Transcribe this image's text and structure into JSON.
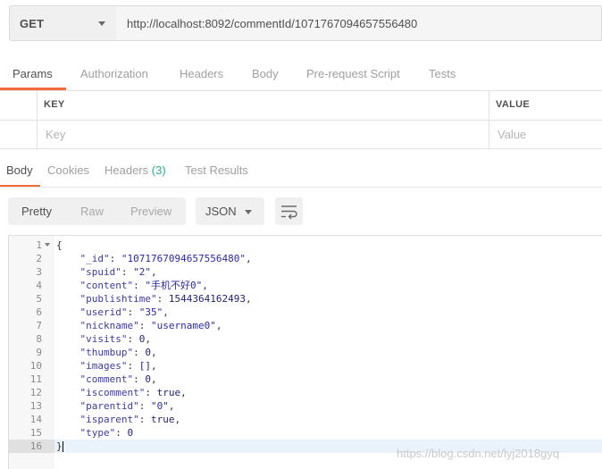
{
  "request": {
    "method": "GET",
    "url": "http://localhost:8092/commentId/1071767094657556480"
  },
  "request_tabs": [
    "Params",
    "Authorization",
    "Headers",
    "Body",
    "Pre-request Script",
    "Tests"
  ],
  "params_table": {
    "key_header": "KEY",
    "value_header": "VALUE",
    "key_placeholder": "Key",
    "value_placeholder": "Value"
  },
  "response_tabs": {
    "body": "Body",
    "cookies": "Cookies",
    "headers": "Headers",
    "headers_count": "(3)",
    "test_results": "Test Results"
  },
  "toolbar": {
    "pretty": "Pretty",
    "raw": "Raw",
    "preview": "Preview",
    "format": "JSON",
    "wrap_icon": "wrap-lines-icon"
  },
  "editor": {
    "lines": [
      {
        "n": "1",
        "text": "{"
      },
      {
        "n": "2",
        "text": "    \"_id\": \"1071767094657556480\","
      },
      {
        "n": "3",
        "text": "    \"spuid\": \"2\","
      },
      {
        "n": "4",
        "text": "    \"content\": \"手机不好0\","
      },
      {
        "n": "5",
        "text": "    \"publishtime\": 1544364162493,"
      },
      {
        "n": "6",
        "text": "    \"userid\": \"35\","
      },
      {
        "n": "7",
        "text": "    \"nickname\": \"username0\","
      },
      {
        "n": "8",
        "text": "    \"visits\": 0,"
      },
      {
        "n": "9",
        "text": "    \"thumbup\": 0,"
      },
      {
        "n": "10",
        "text": "    \"images\": [],"
      },
      {
        "n": "11",
        "text": "    \"comment\": 0,"
      },
      {
        "n": "12",
        "text": "    \"iscomment\": true,"
      },
      {
        "n": "13",
        "text": "    \"parentid\": \"0\","
      },
      {
        "n": "14",
        "text": "    \"isparent\": true,"
      },
      {
        "n": "15",
        "text": "    \"type\": 0"
      },
      {
        "n": "16",
        "text": "}"
      }
    ]
  },
  "watermark": "https://blog.csdn.net/lyj2018gyq",
  "colors": {
    "accent": "#f26b3a",
    "count": "#26b47f"
  }
}
